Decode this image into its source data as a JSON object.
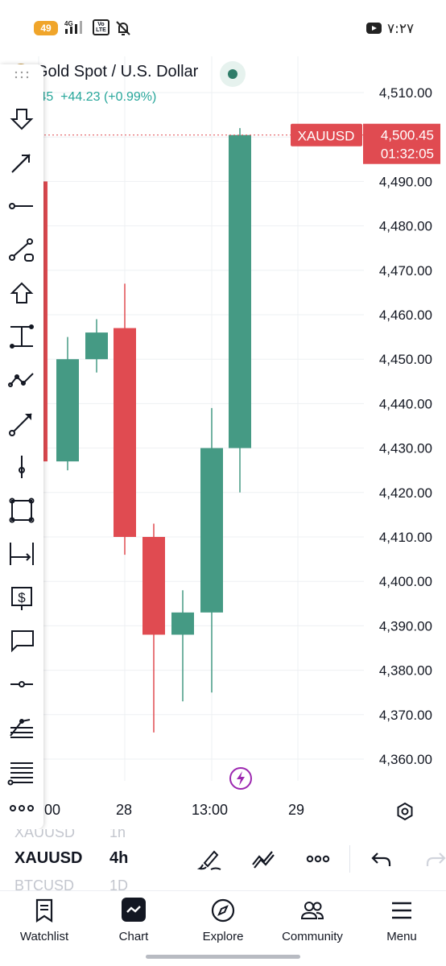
{
  "status_bar": {
    "battery": "49",
    "network": "4G",
    "volte": "Vo LTE",
    "clock": "۷:۲۷"
  },
  "chart": {
    "symbol_title": "Gold Spot / U.S. Dollar",
    "last_price_partial": ".45",
    "change": "+44.23 (+0.99%)",
    "price_tag": {
      "symbol": "XAUUSD",
      "price": "4,500.45",
      "countdown": "01:32:05"
    },
    "colors": {
      "up": "#459a84",
      "down": "#e04b51",
      "grid": "#eef0f3",
      "accent": "#9c27b0"
    },
    "x_labels": [
      "00",
      "28",
      "13:00",
      "29"
    ]
  },
  "chart_data": {
    "type": "candlestick",
    "symbol": "XAUUSD",
    "interval": "4h",
    "ylim": [
      4355,
      4515
    ],
    "y_ticks": [
      "4,510.00",
      "4,500.00",
      "4,490.00",
      "4,480.00",
      "4,470.00",
      "4,460.00",
      "4,450.00",
      "4,440.00",
      "4,430.00",
      "4,420.00",
      "4,410.00",
      "4,400.00",
      "4,390.00",
      "4,380.00",
      "4,370.00",
      "4,360.00"
    ],
    "candles": [
      {
        "open": 4490,
        "high": 4492,
        "low": 4427,
        "close": 4427
      },
      {
        "open": 4427,
        "high": 4455,
        "low": 4425,
        "close": 4450
      },
      {
        "open": 4450,
        "high": 4459,
        "low": 4447,
        "close": 4456
      },
      {
        "open": 4457,
        "high": 4467,
        "low": 4406,
        "close": 4410
      },
      {
        "open": 4410,
        "high": 4413,
        "low": 4366,
        "close": 4388
      },
      {
        "open": 4388,
        "high": 4398,
        "low": 4373,
        "close": 4393
      },
      {
        "open": 4393,
        "high": 4439,
        "low": 4375,
        "close": 4430
      },
      {
        "open": 4430,
        "high": 4502,
        "low": 4420,
        "close": 4500.45
      }
    ],
    "last_price": 4500.45
  },
  "toolbar": {
    "tools": [
      "cursor-arrow-icon",
      "trend-arrow-icon",
      "horizontal-ray-icon",
      "trend-line-icon",
      "arrow-up-marker-icon",
      "date-range-icon",
      "path-icon",
      "arrow-line-icon",
      "vertical-line-icon",
      "rectangle-icon",
      "price-range-icon",
      "money-icon",
      "callout-icon",
      "horizontal-line-icon",
      "fib-icon",
      "parallel-lines-icon",
      "more-icon"
    ]
  },
  "ticker_row": {
    "ghost_top_symbol": "XAUUSD",
    "ghost_top_interval": "1h",
    "symbol": "XAUUSD",
    "interval": "4h",
    "ghost_bottom_symbol": "BTCUSD",
    "ghost_bottom_interval": "1D"
  },
  "bottom_nav": {
    "items": [
      "Watchlist",
      "Chart",
      "Explore",
      "Community",
      "Menu"
    ]
  }
}
